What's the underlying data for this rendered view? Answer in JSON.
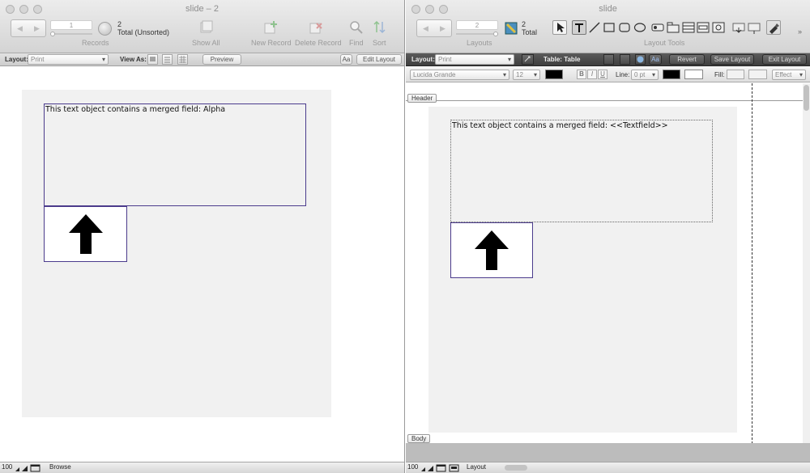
{
  "left_window": {
    "title": "slide – 2",
    "records": {
      "current": "1",
      "total": "2",
      "total_label": "Total (Unsorted)",
      "label": "Records"
    },
    "toolbar": {
      "show_all": "Show All",
      "new_record": "New Record",
      "delete_record": "Delete Record",
      "find": "Find",
      "sort": "Sort"
    },
    "layout_bar": {
      "layout_label": "Layout:",
      "layout_value": "Print",
      "view_as_label": "View As:",
      "preview": "Preview",
      "aa": "Aa",
      "edit_layout": "Edit Layout"
    },
    "content": {
      "text_object": "This text object contains a merged field: Alpha"
    },
    "status": {
      "zoom": "100",
      "mode": "Browse"
    }
  },
  "right_window": {
    "title": "slide",
    "layouts": {
      "current": "2",
      "total": "2",
      "total_label": "Total",
      "label": "Layouts"
    },
    "layout_tools_label": "Layout Tools",
    "layout_bar": {
      "layout_label": "Layout:",
      "layout_value": "Print",
      "table_label": "Table: Table",
      "aa": "Aa",
      "revert": "Revert",
      "save_layout": "Save Layout",
      "exit_layout": "Exit Layout"
    },
    "format_bar": {
      "font": "Lucida Grande",
      "size": "12",
      "bold": "B",
      "italic": "I",
      "underline": "U",
      "line_label": "Line:",
      "line_value": "0 pt",
      "fill_label": "Fill:",
      "effect": "Effect",
      "text_color": "#000000",
      "line_color": "#000000",
      "fill_color": "#ffffff"
    },
    "parts": {
      "header": "Header",
      "body": "Body"
    },
    "content": {
      "text_object": "This text object contains a merged field: <<Textfield>>"
    },
    "status": {
      "zoom": "100",
      "mode": "Layout"
    }
  },
  "icons": {
    "arrow": "up-arrow-icon",
    "stepper_left": "triangle-left",
    "stepper_right": "triangle-right"
  }
}
